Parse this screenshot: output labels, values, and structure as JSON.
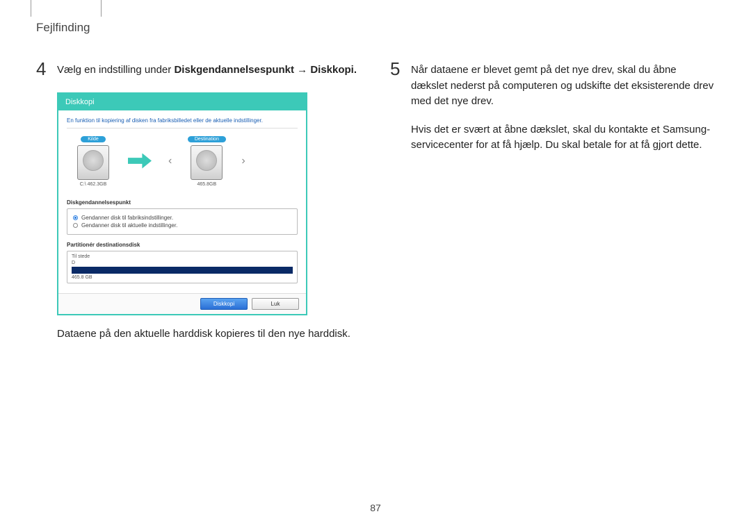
{
  "header": {
    "title": "Fejlfinding"
  },
  "page_number": "87",
  "left": {
    "step_num": "4",
    "step_text_prefix": "Vælg en indstilling under ",
    "step_text_bold": "Diskgendannelsespunkt → Diskkopi.",
    "caption": "Dataene på den aktuelle harddisk kopieres til den nye harddisk."
  },
  "right": {
    "step_num": "5",
    "step_text": "Når dataene er blevet gemt på det nye drev, skal du åbne dækslet nederst på computeren og udskifte det eksisterende drev med det nye drev.",
    "followup": "Hvis det er svært at åbne dækslet, skal du kontakte et Samsung-servicecenter for at få hjælp. Du skal betale for at få gjort dette."
  },
  "dialog": {
    "title": "Diskkopi",
    "description": "En funktion til kopiering af disken fra fabriksbilledet eller de aktuelle indstillinger.",
    "source": {
      "badge": "Kilde",
      "label": "C:\\ 462.3GB"
    },
    "destination": {
      "badge": "Destination",
      "label": "465.8GB"
    },
    "section_recovery": "Diskgendannelsespunkt",
    "radio1": "Gendanner disk til fabriksindstillinger.",
    "radio2": "Gendanner disk til aktuelle indstillinger.",
    "section_partition": "Partitionér destinationsdisk",
    "partition_status": "Til stede",
    "partition_letter": "D",
    "partition_size": "465.8 GB",
    "btn_primary": "Diskkopi",
    "btn_secondary": "Luk"
  }
}
